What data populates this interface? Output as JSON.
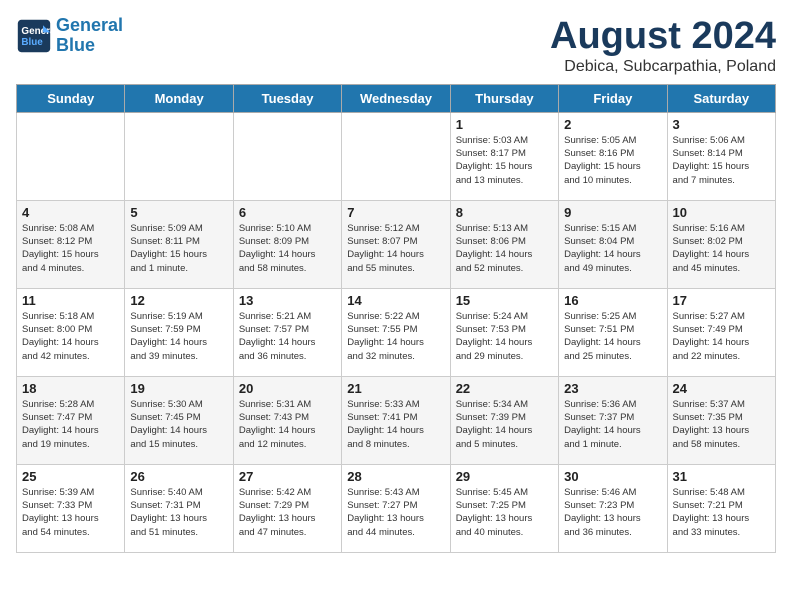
{
  "header": {
    "logo_line1": "General",
    "logo_line2": "Blue",
    "title": "August 2024",
    "subtitle": "Debica, Subcarpathia, Poland"
  },
  "days_of_week": [
    "Sunday",
    "Monday",
    "Tuesday",
    "Wednesday",
    "Thursday",
    "Friday",
    "Saturday"
  ],
  "weeks": [
    [
      {
        "day": "",
        "info": ""
      },
      {
        "day": "",
        "info": ""
      },
      {
        "day": "",
        "info": ""
      },
      {
        "day": "",
        "info": ""
      },
      {
        "day": "1",
        "info": "Sunrise: 5:03 AM\nSunset: 8:17 PM\nDaylight: 15 hours\nand 13 minutes."
      },
      {
        "day": "2",
        "info": "Sunrise: 5:05 AM\nSunset: 8:16 PM\nDaylight: 15 hours\nand 10 minutes."
      },
      {
        "day": "3",
        "info": "Sunrise: 5:06 AM\nSunset: 8:14 PM\nDaylight: 15 hours\nand 7 minutes."
      }
    ],
    [
      {
        "day": "4",
        "info": "Sunrise: 5:08 AM\nSunset: 8:12 PM\nDaylight: 15 hours\nand 4 minutes."
      },
      {
        "day": "5",
        "info": "Sunrise: 5:09 AM\nSunset: 8:11 PM\nDaylight: 15 hours\nand 1 minute."
      },
      {
        "day": "6",
        "info": "Sunrise: 5:10 AM\nSunset: 8:09 PM\nDaylight: 14 hours\nand 58 minutes."
      },
      {
        "day": "7",
        "info": "Sunrise: 5:12 AM\nSunset: 8:07 PM\nDaylight: 14 hours\nand 55 minutes."
      },
      {
        "day": "8",
        "info": "Sunrise: 5:13 AM\nSunset: 8:06 PM\nDaylight: 14 hours\nand 52 minutes."
      },
      {
        "day": "9",
        "info": "Sunrise: 5:15 AM\nSunset: 8:04 PM\nDaylight: 14 hours\nand 49 minutes."
      },
      {
        "day": "10",
        "info": "Sunrise: 5:16 AM\nSunset: 8:02 PM\nDaylight: 14 hours\nand 45 minutes."
      }
    ],
    [
      {
        "day": "11",
        "info": "Sunrise: 5:18 AM\nSunset: 8:00 PM\nDaylight: 14 hours\nand 42 minutes."
      },
      {
        "day": "12",
        "info": "Sunrise: 5:19 AM\nSunset: 7:59 PM\nDaylight: 14 hours\nand 39 minutes."
      },
      {
        "day": "13",
        "info": "Sunrise: 5:21 AM\nSunset: 7:57 PM\nDaylight: 14 hours\nand 36 minutes."
      },
      {
        "day": "14",
        "info": "Sunrise: 5:22 AM\nSunset: 7:55 PM\nDaylight: 14 hours\nand 32 minutes."
      },
      {
        "day": "15",
        "info": "Sunrise: 5:24 AM\nSunset: 7:53 PM\nDaylight: 14 hours\nand 29 minutes."
      },
      {
        "day": "16",
        "info": "Sunrise: 5:25 AM\nSunset: 7:51 PM\nDaylight: 14 hours\nand 25 minutes."
      },
      {
        "day": "17",
        "info": "Sunrise: 5:27 AM\nSunset: 7:49 PM\nDaylight: 14 hours\nand 22 minutes."
      }
    ],
    [
      {
        "day": "18",
        "info": "Sunrise: 5:28 AM\nSunset: 7:47 PM\nDaylight: 14 hours\nand 19 minutes."
      },
      {
        "day": "19",
        "info": "Sunrise: 5:30 AM\nSunset: 7:45 PM\nDaylight: 14 hours\nand 15 minutes."
      },
      {
        "day": "20",
        "info": "Sunrise: 5:31 AM\nSunset: 7:43 PM\nDaylight: 14 hours\nand 12 minutes."
      },
      {
        "day": "21",
        "info": "Sunrise: 5:33 AM\nSunset: 7:41 PM\nDaylight: 14 hours\nand 8 minutes."
      },
      {
        "day": "22",
        "info": "Sunrise: 5:34 AM\nSunset: 7:39 PM\nDaylight: 14 hours\nand 5 minutes."
      },
      {
        "day": "23",
        "info": "Sunrise: 5:36 AM\nSunset: 7:37 PM\nDaylight: 14 hours\nand 1 minute."
      },
      {
        "day": "24",
        "info": "Sunrise: 5:37 AM\nSunset: 7:35 PM\nDaylight: 13 hours\nand 58 minutes."
      }
    ],
    [
      {
        "day": "25",
        "info": "Sunrise: 5:39 AM\nSunset: 7:33 PM\nDaylight: 13 hours\nand 54 minutes."
      },
      {
        "day": "26",
        "info": "Sunrise: 5:40 AM\nSunset: 7:31 PM\nDaylight: 13 hours\nand 51 minutes."
      },
      {
        "day": "27",
        "info": "Sunrise: 5:42 AM\nSunset: 7:29 PM\nDaylight: 13 hours\nand 47 minutes."
      },
      {
        "day": "28",
        "info": "Sunrise: 5:43 AM\nSunset: 7:27 PM\nDaylight: 13 hours\nand 44 minutes."
      },
      {
        "day": "29",
        "info": "Sunrise: 5:45 AM\nSunset: 7:25 PM\nDaylight: 13 hours\nand 40 minutes."
      },
      {
        "day": "30",
        "info": "Sunrise: 5:46 AM\nSunset: 7:23 PM\nDaylight: 13 hours\nand 36 minutes."
      },
      {
        "day": "31",
        "info": "Sunrise: 5:48 AM\nSunset: 7:21 PM\nDaylight: 13 hours\nand 33 minutes."
      }
    ]
  ]
}
